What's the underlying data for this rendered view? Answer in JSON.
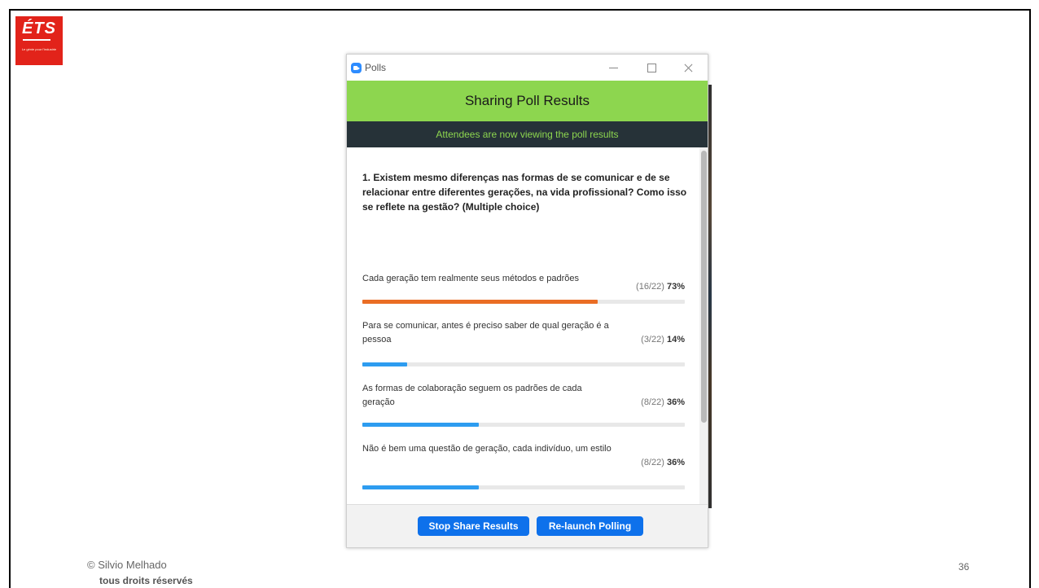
{
  "slide": {
    "logo_text": "ÉTS",
    "logo_tagline": "Le génie pour l'industrie",
    "copyright": "© Silvio Melhado",
    "rights": "tous droits réservés",
    "page_number": "36"
  },
  "window": {
    "title": "Polls",
    "minimize_icon": "minimize-icon",
    "maximize_icon": "maximize-icon",
    "close_icon": "close-icon"
  },
  "header": {
    "title": "Sharing Poll Results",
    "subtitle": "Attendees are now viewing the poll results"
  },
  "question": "1. Existem mesmo diferenças nas formas de se comunicar e de se relacionar entre diferentes gerações, na vida profissional? Como isso se reflete na gestão? (Multiple choice)",
  "options": [
    {
      "label": "Cada geração tem realmente seus métodos e padrões",
      "count": "(16/22)",
      "percent": "73%",
      "fraction": 0.73,
      "color": "#ea6d24"
    },
    {
      "label": "Para se comunicar, antes é preciso saber de qual geração é a pessoa",
      "count": "(3/22)",
      "percent": "14%",
      "fraction": 0.14,
      "color": "#2d9cf0"
    },
    {
      "label": "As formas de colaboração seguem os padrões de cada geração",
      "count": "(8/22)",
      "percent": "36%",
      "fraction": 0.36,
      "color": "#2d9cf0"
    },
    {
      "label": "Não é bem uma questão de geração, cada indivíduo, um estilo",
      "count": "(8/22)",
      "percent": "36%",
      "fraction": 0.36,
      "color": "#2d9cf0"
    }
  ],
  "buttons": {
    "stop_share": "Stop Share Results",
    "relaunch": "Re-launch Polling"
  },
  "colors": {
    "header_green": "#8dd64f",
    "header_dark": "#263238",
    "button_blue": "#0e71eb",
    "logo_red": "#e2231a"
  }
}
